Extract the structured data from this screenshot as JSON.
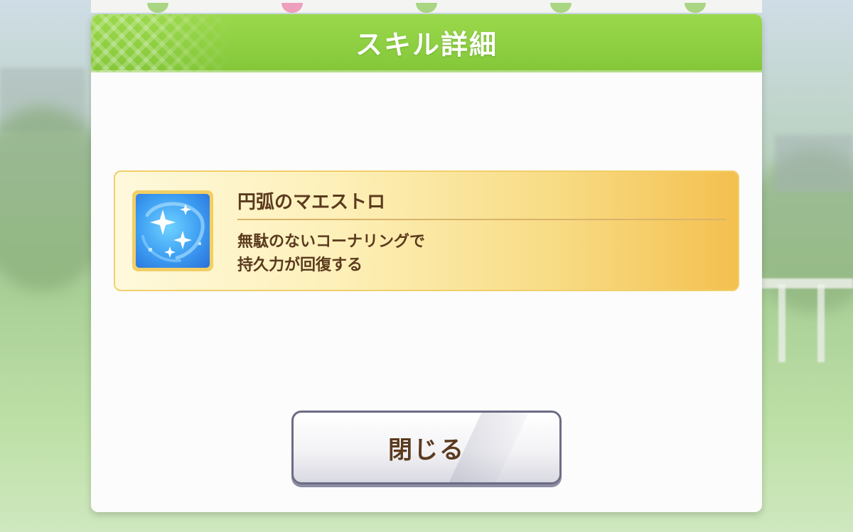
{
  "dialog": {
    "title": "スキル詳細"
  },
  "skill": {
    "icon": "sparkle-orb-icon",
    "name": "円弧のマエストロ",
    "description_lines": [
      "無駄のないコーナリングで",
      "持久力が回復する"
    ]
  },
  "actions": {
    "close_label": "閉じる"
  },
  "colors": {
    "header_green": "#84c83a",
    "card_gold": "#f4c04f",
    "text_brown": "#5b3a1e",
    "icon_blue": "#3c9df2"
  }
}
